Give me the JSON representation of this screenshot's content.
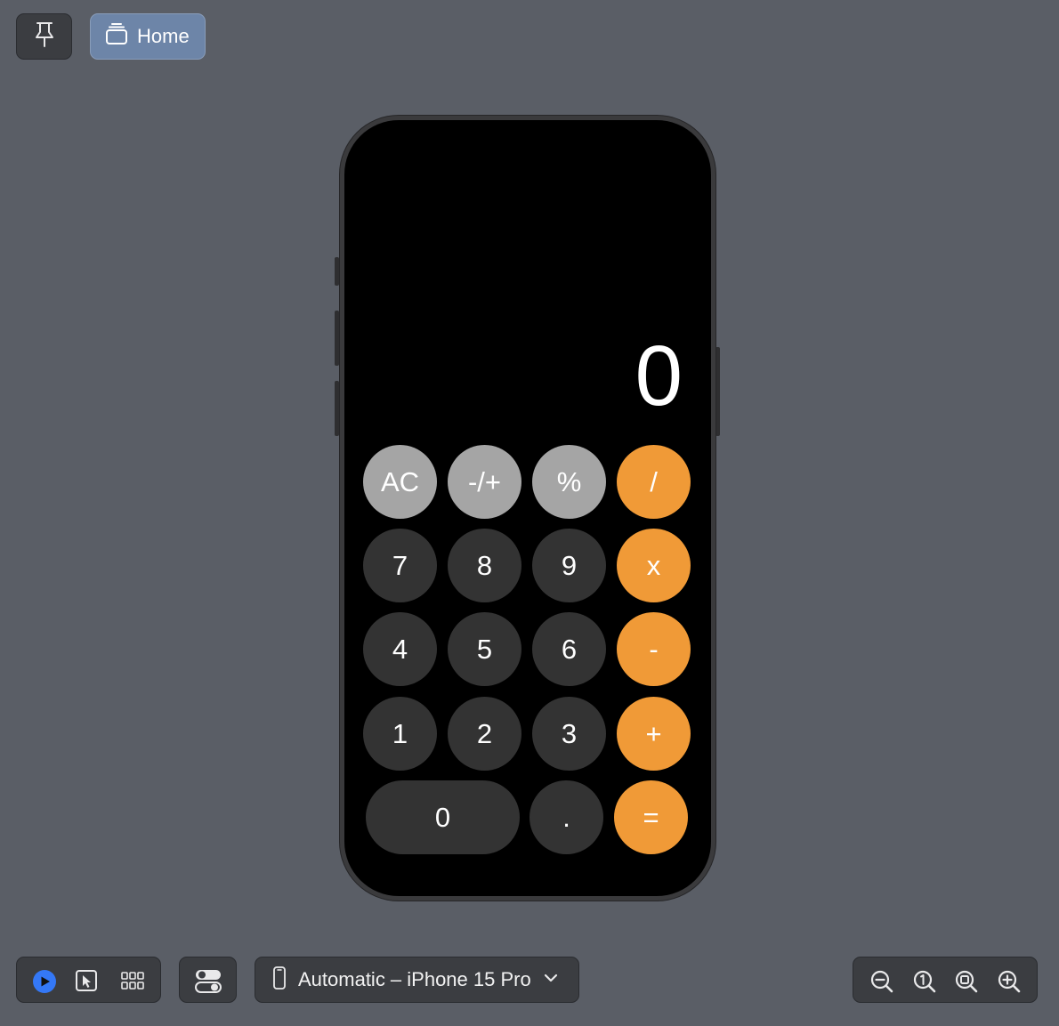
{
  "toolbar": {
    "home_label": "Home",
    "pin_icon": "pin-icon",
    "home_icon": "stack-icon"
  },
  "calculator": {
    "display": "0",
    "rows": [
      [
        {
          "label": "AC",
          "style": "light"
        },
        {
          "label": "-/+",
          "style": "light"
        },
        {
          "label": "%",
          "style": "light"
        },
        {
          "label": "/",
          "style": "orange"
        }
      ],
      [
        {
          "label": "7",
          "style": "dark"
        },
        {
          "label": "8",
          "style": "dark"
        },
        {
          "label": "9",
          "style": "dark"
        },
        {
          "label": "x",
          "style": "orange"
        }
      ],
      [
        {
          "label": "4",
          "style": "dark"
        },
        {
          "label": "5",
          "style": "dark"
        },
        {
          "label": "6",
          "style": "dark"
        },
        {
          "label": "-",
          "style": "orange"
        }
      ],
      [
        {
          "label": "1",
          "style": "dark"
        },
        {
          "label": "2",
          "style": "dark"
        },
        {
          "label": "3",
          "style": "dark"
        },
        {
          "label": "+",
          "style": "orange"
        }
      ],
      [
        {
          "label": "0",
          "style": "dark"
        },
        {
          "label": ".",
          "style": "dark"
        },
        {
          "label": "=",
          "style": "orange"
        }
      ]
    ],
    "colors": {
      "light": "#a5a5a5",
      "dark": "#333333",
      "orange": "#f09a37"
    }
  },
  "bottom_bar": {
    "device_label": "Automatic – iPhone 15 Pro",
    "icons": [
      "live-preview-icon",
      "selectable-icon",
      "variants-grid-icon",
      "device-settings-icon",
      "iphone-icon",
      "chevron-down-icon",
      "zoom-out-icon",
      "zoom-actual-icon",
      "zoom-fit-icon",
      "zoom-in-icon"
    ]
  }
}
